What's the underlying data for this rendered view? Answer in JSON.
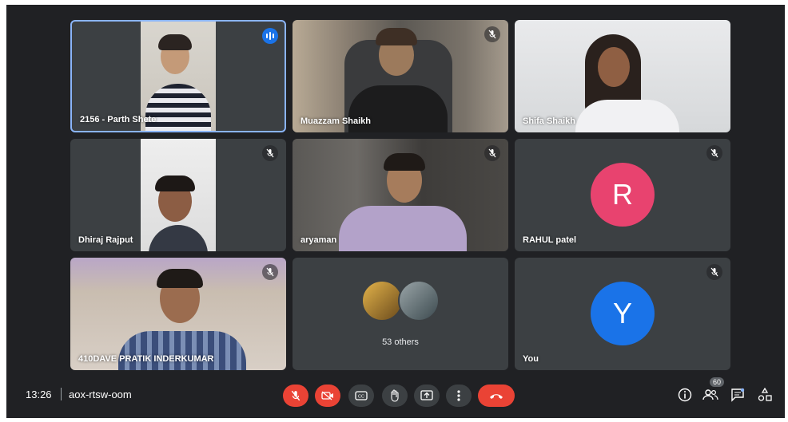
{
  "participants": [
    {
      "name": "2156 - Parth Shete",
      "speaking": true
    },
    {
      "name": "Muazzam Shaikh",
      "muted": true
    },
    {
      "name": "Shifa Shaikh"
    },
    {
      "name": "Dhiraj Rajput",
      "muted": true
    },
    {
      "name": "aryaman",
      "muted": true
    },
    {
      "name": "RAHUL patel",
      "muted": true,
      "initial": "R",
      "avatar_color": "#e8436f"
    },
    {
      "name": "410DAVE PRATIK INDERKUMAR",
      "muted": true
    },
    {
      "name": "You",
      "muted": true,
      "initial": "Y",
      "avatar_color": "#1a73e8"
    }
  ],
  "others": {
    "label": "53 others"
  },
  "bottom_bar": {
    "time": "13:26",
    "meeting_code": "aox-rtsw-oom",
    "people_count": "60",
    "controls": [
      "mic-off",
      "camera-off",
      "captions",
      "raise-hand",
      "present",
      "more-options",
      "leave-call"
    ]
  },
  "colors": {
    "background": "#202124",
    "tile": "#3c4043",
    "accent": "#8ab4f8",
    "danger": "#ea4335"
  }
}
